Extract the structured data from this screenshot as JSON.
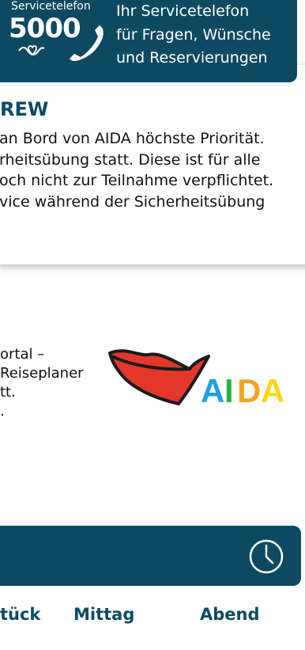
{
  "service_banner": {
    "label": "Servicetelefon",
    "number": "5000",
    "lines": [
      "Ihr Servicetelefon",
      "für Fragen, Wünsche",
      "und Reservierungen"
    ]
  },
  "notice_card": {
    "title": "REW",
    "lines": [
      "an Bord von AIDA höchste Priorität.",
      "rheitsübung statt. Diese ist für alle",
      "och nicht zur Teilnahme verpflichtet.",
      "vice während der Sicherheitsübung"
    ]
  },
  "portal_section": {
    "lines": [
      "ortal –",
      " Reiseplaner",
      "tt.",
      "."
    ],
    "logo_text": "AIDA"
  },
  "meal_tabs": [
    "tück",
    "Mittag",
    "Abend"
  ],
  "colors": {
    "brand_blue": "#0d4a62",
    "lips_red": "#e3372b",
    "lips_outline": "#1a1a1a"
  },
  "icons": {
    "clock": "clock-icon",
    "phone": "phone-icon",
    "heart": "heart-icon"
  }
}
